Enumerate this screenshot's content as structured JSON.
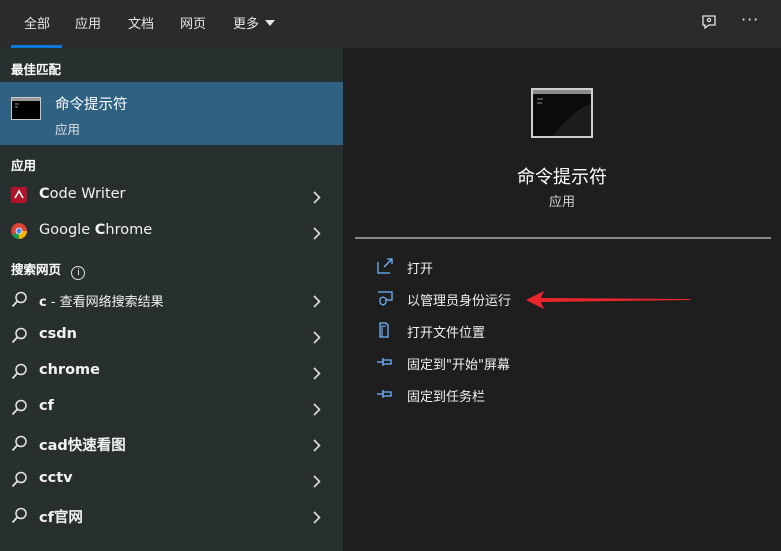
{
  "tabs": [
    "全部",
    "应用",
    "文档",
    "网页",
    "更多"
  ],
  "left": {
    "best_match_title": "最佳匹配",
    "best_match": {
      "title": "命令提示符",
      "subtitle": "应用"
    },
    "apps_title": "应用",
    "apps": [
      {
        "bold": "C",
        "rest": "ode Writer",
        "icon": "code-writer-icon"
      },
      {
        "bold": "",
        "rest": "Google ",
        "bold2": "C",
        "rest2": "hrome",
        "icon": "chrome-icon"
      }
    ],
    "web_title": "搜索网页",
    "web_results": [
      {
        "bold": "c",
        "rest": " - 查看网络搜索结果"
      },
      {
        "bold": "c",
        "rest": "sdn"
      },
      {
        "bold": "c",
        "rest": "hrome"
      },
      {
        "bold": "c",
        "rest": "f"
      },
      {
        "bold": "c",
        "rest": "ad快速看图"
      },
      {
        "bold": "c",
        "rest": "ctv"
      },
      {
        "bold": "c",
        "rest": "f官网"
      }
    ]
  },
  "right": {
    "title": "命令提示符",
    "subtitle": "应用",
    "actions": [
      {
        "label": "打开",
        "icon": "open-icon"
      },
      {
        "label": "以管理员身份运行",
        "icon": "run-as-admin-icon"
      },
      {
        "label": "打开文件位置",
        "icon": "file-location-icon"
      },
      {
        "label": "固定到\"开始\"屏幕",
        "icon": "pin-icon"
      },
      {
        "label": "固定到任务栏",
        "icon": "pin-icon"
      }
    ]
  },
  "colors": {
    "accent": "#0a78d7",
    "selected": "#2f6183",
    "arrow": "#e8262c"
  }
}
